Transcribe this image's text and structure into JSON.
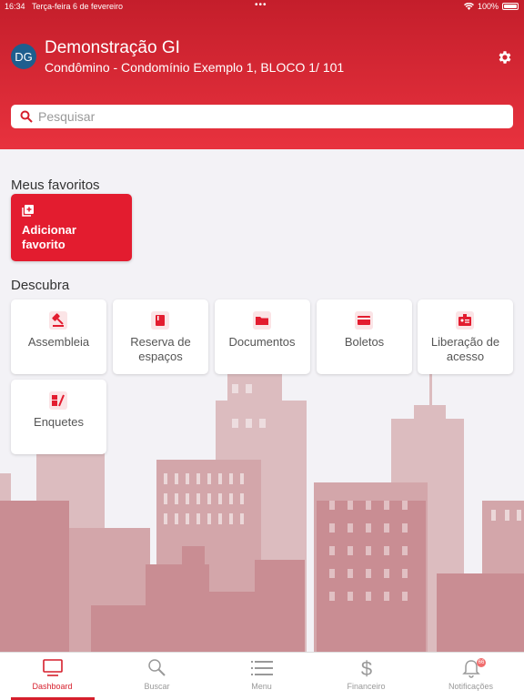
{
  "status_bar": {
    "time": "16:34",
    "date": "Terça-feira 6 de fevereiro",
    "dots": "•••",
    "battery": "100%"
  },
  "header": {
    "avatar_initials": "DG",
    "user_name": "Demonstração GI",
    "user_subtitle": "Condômino - Condomínio Exemplo 1, BLOCO 1/ 101"
  },
  "search": {
    "placeholder": "Pesquisar"
  },
  "favorites": {
    "title": "Meus favoritos",
    "add_label": "Adicionar favorito"
  },
  "discover": {
    "title": "Descubra",
    "items": [
      {
        "label": "Assembleia",
        "icon": "gavel-icon"
      },
      {
        "label": "Reserva de espaços",
        "icon": "book-icon"
      },
      {
        "label": "Documentos",
        "icon": "folder-icon"
      },
      {
        "label": "Boletos",
        "icon": "card-icon"
      },
      {
        "label": "Liberação de acesso",
        "icon": "badge-icon"
      },
      {
        "label": "Enquetes",
        "icon": "poll-icon"
      }
    ]
  },
  "tabbar": {
    "items": [
      {
        "label": "Dashboard",
        "icon": "monitor-icon"
      },
      {
        "label": "Buscar",
        "icon": "search-icon"
      },
      {
        "label": "Menu",
        "icon": "list-icon"
      },
      {
        "label": "Financeiro",
        "icon": "dollar-icon"
      },
      {
        "label": "Notificações",
        "icon": "bell-icon"
      }
    ],
    "notification_count": "66"
  },
  "colors": {
    "brand": "#e31c2f",
    "header_top": "#c41e2b",
    "avatar": "#1e5e8e",
    "city": "#c98d93"
  }
}
